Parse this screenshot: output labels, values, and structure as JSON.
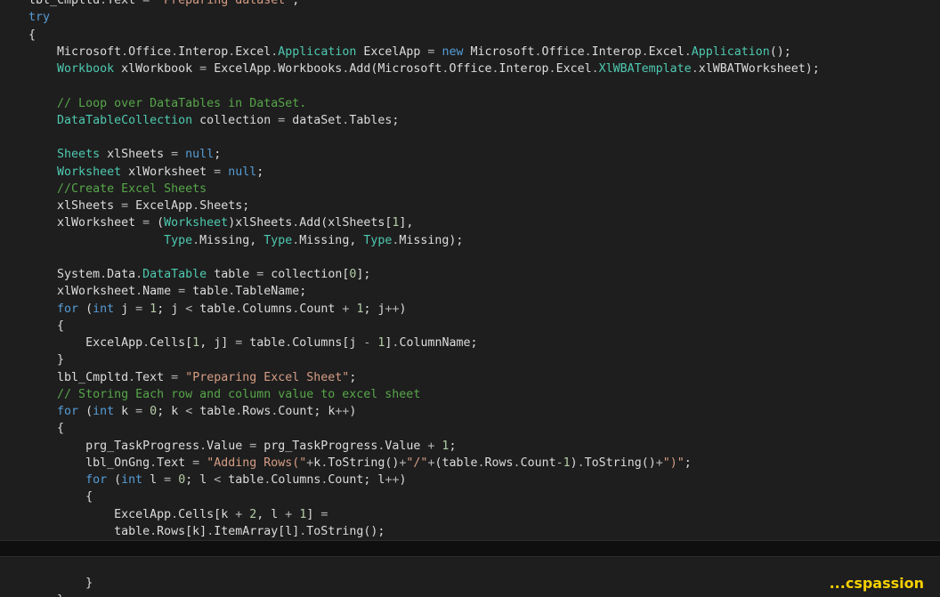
{
  "theme": {
    "background": "#1e1e1e",
    "keyword": "#569cd6",
    "type": "#4ec9b0",
    "string": "#d69d85",
    "comment": "#57a64a",
    "number": "#b5cea8",
    "operator": "#b4b4b4",
    "plain": "#dcdcdc",
    "watermark": "#f5d000"
  },
  "editor": {
    "current_line": 33,
    "lines": [
      [
        [
          "p",
          "    lbl_Cmpltd"
        ],
        [
          "o",
          "."
        ],
        [
          "p",
          "Text "
        ],
        [
          "o",
          "="
        ],
        [
          "p",
          " "
        ],
        [
          "s",
          "\"Preparing dataset\""
        ],
        [
          "p",
          ";"
        ]
      ],
      [
        [
          "k",
          "    try"
        ]
      ],
      [
        [
          "p",
          "    {"
        ]
      ],
      [
        [
          "p",
          "        Microsoft"
        ],
        [
          "o",
          "."
        ],
        [
          "p",
          "Office"
        ],
        [
          "o",
          "."
        ],
        [
          "p",
          "Interop"
        ],
        [
          "o",
          "."
        ],
        [
          "p",
          "Excel"
        ],
        [
          "o",
          "."
        ],
        [
          "t",
          "Application"
        ],
        [
          "p",
          " ExcelApp "
        ],
        [
          "o",
          "="
        ],
        [
          "p",
          " "
        ],
        [
          "k",
          "new"
        ],
        [
          "p",
          " Microsoft"
        ],
        [
          "o",
          "."
        ],
        [
          "p",
          "Office"
        ],
        [
          "o",
          "."
        ],
        [
          "p",
          "Interop"
        ],
        [
          "o",
          "."
        ],
        [
          "p",
          "Excel"
        ],
        [
          "o",
          "."
        ],
        [
          "t",
          "Application"
        ],
        [
          "p",
          "();"
        ]
      ],
      [
        [
          "t",
          "        Workbook"
        ],
        [
          "p",
          " xlWorkbook "
        ],
        [
          "o",
          "="
        ],
        [
          "p",
          " ExcelApp"
        ],
        [
          "o",
          "."
        ],
        [
          "p",
          "Workbooks"
        ],
        [
          "o",
          "."
        ],
        [
          "p",
          "Add(Microsoft"
        ],
        [
          "o",
          "."
        ],
        [
          "p",
          "Office"
        ],
        [
          "o",
          "."
        ],
        [
          "p",
          "Interop"
        ],
        [
          "o",
          "."
        ],
        [
          "p",
          "Excel"
        ],
        [
          "o",
          "."
        ],
        [
          "t",
          "XlWBATemplate"
        ],
        [
          "o",
          "."
        ],
        [
          "p",
          "xlWBATWorksheet);"
        ]
      ],
      [],
      [
        [
          "c",
          "        // Loop over DataTables in DataSet."
        ]
      ],
      [
        [
          "t",
          "        DataTableCollection"
        ],
        [
          "p",
          " collection "
        ],
        [
          "o",
          "="
        ],
        [
          "p",
          " dataSet"
        ],
        [
          "o",
          "."
        ],
        [
          "p",
          "Tables;"
        ]
      ],
      [],
      [
        [
          "t",
          "        Sheets"
        ],
        [
          "p",
          " xlSheets "
        ],
        [
          "o",
          "="
        ],
        [
          "p",
          " "
        ],
        [
          "k",
          "null"
        ],
        [
          "p",
          ";"
        ]
      ],
      [
        [
          "t",
          "        Worksheet"
        ],
        [
          "p",
          " xlWorksheet "
        ],
        [
          "o",
          "="
        ],
        [
          "p",
          " "
        ],
        [
          "k",
          "null"
        ],
        [
          "p",
          ";"
        ]
      ],
      [
        [
          "c",
          "        //Create Excel Sheets"
        ]
      ],
      [
        [
          "p",
          "        xlSheets "
        ],
        [
          "o",
          "="
        ],
        [
          "p",
          " ExcelApp"
        ],
        [
          "o",
          "."
        ],
        [
          "p",
          "Sheets;"
        ]
      ],
      [
        [
          "p",
          "        xlWorksheet "
        ],
        [
          "o",
          "="
        ],
        [
          "p",
          " ("
        ],
        [
          "t",
          "Worksheet"
        ],
        [
          "p",
          ")xlSheets"
        ],
        [
          "o",
          "."
        ],
        [
          "p",
          "Add(xlSheets["
        ],
        [
          "n",
          "1"
        ],
        [
          "p",
          "],"
        ]
      ],
      [
        [
          "t",
          "                       Type"
        ],
        [
          "o",
          "."
        ],
        [
          "p",
          "Missing, "
        ],
        [
          "t",
          "Type"
        ],
        [
          "o",
          "."
        ],
        [
          "p",
          "Missing, "
        ],
        [
          "t",
          "Type"
        ],
        [
          "o",
          "."
        ],
        [
          "p",
          "Missing);"
        ]
      ],
      [],
      [
        [
          "p",
          "        System"
        ],
        [
          "o",
          "."
        ],
        [
          "p",
          "Data"
        ],
        [
          "o",
          "."
        ],
        [
          "t",
          "DataTable"
        ],
        [
          "p",
          " table "
        ],
        [
          "o",
          "="
        ],
        [
          "p",
          " collection["
        ],
        [
          "n",
          "0"
        ],
        [
          "p",
          "];"
        ]
      ],
      [
        [
          "p",
          "        xlWorksheet"
        ],
        [
          "o",
          "."
        ],
        [
          "p",
          "Name "
        ],
        [
          "o",
          "="
        ],
        [
          "p",
          " table"
        ],
        [
          "o",
          "."
        ],
        [
          "p",
          "TableName;"
        ]
      ],
      [
        [
          "k",
          "        for"
        ],
        [
          "p",
          " ("
        ],
        [
          "k",
          "int"
        ],
        [
          "p",
          " j "
        ],
        [
          "o",
          "="
        ],
        [
          "p",
          " "
        ],
        [
          "n",
          "1"
        ],
        [
          "p",
          "; j "
        ],
        [
          "o",
          "<"
        ],
        [
          "p",
          " table"
        ],
        [
          "o",
          "."
        ],
        [
          "p",
          "Columns"
        ],
        [
          "o",
          "."
        ],
        [
          "p",
          "Count "
        ],
        [
          "o",
          "+"
        ],
        [
          "p",
          " "
        ],
        [
          "n",
          "1"
        ],
        [
          "p",
          "; j"
        ],
        [
          "o",
          "++"
        ],
        [
          "p",
          ")"
        ]
      ],
      [
        [
          "p",
          "        {"
        ]
      ],
      [
        [
          "p",
          "            ExcelApp"
        ],
        [
          "o",
          "."
        ],
        [
          "p",
          "Cells["
        ],
        [
          "n",
          "1"
        ],
        [
          "p",
          ", j] "
        ],
        [
          "o",
          "="
        ],
        [
          "p",
          " table"
        ],
        [
          "o",
          "."
        ],
        [
          "p",
          "Columns[j "
        ],
        [
          "o",
          "-"
        ],
        [
          "p",
          " "
        ],
        [
          "n",
          "1"
        ],
        [
          "p",
          "]"
        ],
        [
          "o",
          "."
        ],
        [
          "p",
          "ColumnName;"
        ]
      ],
      [
        [
          "p",
          "        }"
        ]
      ],
      [
        [
          "p",
          "        lbl_Cmpltd"
        ],
        [
          "o",
          "."
        ],
        [
          "p",
          "Text "
        ],
        [
          "o",
          "="
        ],
        [
          "p",
          " "
        ],
        [
          "s",
          "\"Preparing Excel Sheet\""
        ],
        [
          "p",
          ";"
        ]
      ],
      [
        [
          "c",
          "        // Storing Each row and column value to excel sheet"
        ]
      ],
      [
        [
          "k",
          "        for"
        ],
        [
          "p",
          " ("
        ],
        [
          "k",
          "int"
        ],
        [
          "p",
          " k "
        ],
        [
          "o",
          "="
        ],
        [
          "p",
          " "
        ],
        [
          "n",
          "0"
        ],
        [
          "p",
          "; k "
        ],
        [
          "o",
          "<"
        ],
        [
          "p",
          " table"
        ],
        [
          "o",
          "."
        ],
        [
          "p",
          "Rows"
        ],
        [
          "o",
          "."
        ],
        [
          "p",
          "Count; k"
        ],
        [
          "o",
          "++"
        ],
        [
          "p",
          ")"
        ]
      ],
      [
        [
          "p",
          "        {"
        ]
      ],
      [
        [
          "p",
          "            prg_TaskProgress"
        ],
        [
          "o",
          "."
        ],
        [
          "p",
          "Value "
        ],
        [
          "o",
          "="
        ],
        [
          "p",
          " prg_TaskProgress"
        ],
        [
          "o",
          "."
        ],
        [
          "p",
          "Value "
        ],
        [
          "o",
          "+"
        ],
        [
          "p",
          " "
        ],
        [
          "n",
          "1"
        ],
        [
          "p",
          ";"
        ]
      ],
      [
        [
          "p",
          "            lbl_OnGng"
        ],
        [
          "o",
          "."
        ],
        [
          "p",
          "Text "
        ],
        [
          "o",
          "="
        ],
        [
          "p",
          " "
        ],
        [
          "s",
          "\"Adding Rows(\""
        ],
        [
          "o",
          "+"
        ],
        [
          "p",
          "k"
        ],
        [
          "o",
          "."
        ],
        [
          "p",
          "ToString()"
        ],
        [
          "o",
          "+"
        ],
        [
          "s",
          "\"/\""
        ],
        [
          "o",
          "+"
        ],
        [
          "p",
          "(table"
        ],
        [
          "o",
          "."
        ],
        [
          "p",
          "Rows"
        ],
        [
          "o",
          "."
        ],
        [
          "p",
          "Count"
        ],
        [
          "o",
          "-"
        ],
        [
          "n",
          "1"
        ],
        [
          "p",
          ")"
        ],
        [
          "o",
          "."
        ],
        [
          "p",
          "ToString()"
        ],
        [
          "o",
          "+"
        ],
        [
          "s",
          "\")\""
        ],
        [
          "p",
          ";"
        ]
      ],
      [
        [
          "k",
          "            for"
        ],
        [
          "p",
          " ("
        ],
        [
          "k",
          "int"
        ],
        [
          "p",
          " l "
        ],
        [
          "o",
          "="
        ],
        [
          "p",
          " "
        ],
        [
          "n",
          "0"
        ],
        [
          "p",
          "; l "
        ],
        [
          "o",
          "<"
        ],
        [
          "p",
          " table"
        ],
        [
          "o",
          "."
        ],
        [
          "p",
          "Columns"
        ],
        [
          "o",
          "."
        ],
        [
          "p",
          "Count; l"
        ],
        [
          "o",
          "++"
        ],
        [
          "p",
          ")"
        ]
      ],
      [
        [
          "p",
          "            {"
        ]
      ],
      [
        [
          "p",
          "                ExcelApp"
        ],
        [
          "o",
          "."
        ],
        [
          "p",
          "Cells[k "
        ],
        [
          "o",
          "+"
        ],
        [
          "p",
          " "
        ],
        [
          "n",
          "2"
        ],
        [
          "p",
          ", l "
        ],
        [
          "o",
          "+"
        ],
        [
          "p",
          " "
        ],
        [
          "n",
          "1"
        ],
        [
          "p",
          "] "
        ],
        [
          "o",
          "="
        ]
      ],
      [
        [
          "p",
          "                table"
        ],
        [
          "o",
          "."
        ],
        [
          "p",
          "Rows[k]"
        ],
        [
          "o",
          "."
        ],
        [
          "p",
          "ItemArray[l]"
        ],
        [
          "o",
          "."
        ],
        [
          "p",
          "ToString();"
        ]
      ],
      [],
      [],
      [
        [
          "p",
          "            }"
        ]
      ],
      [
        [
          "p",
          "        }"
        ]
      ]
    ]
  },
  "watermark": {
    "text": "...cspassion"
  }
}
